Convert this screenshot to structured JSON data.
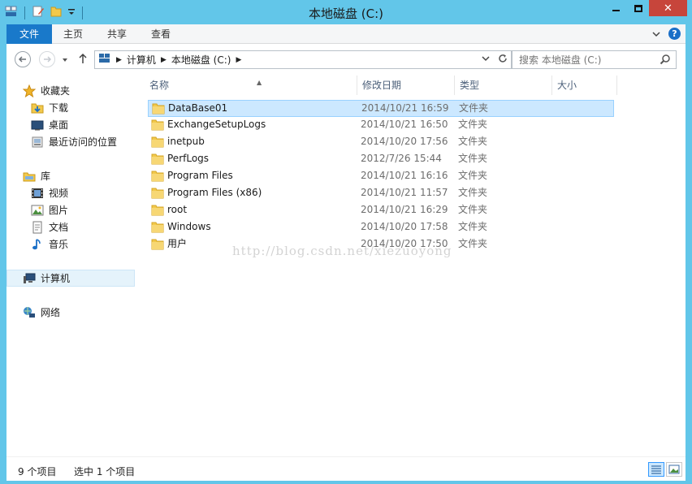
{
  "window": {
    "title": "本地磁盘 (C:)"
  },
  "ribbon": {
    "tabs": [
      "文件",
      "主页",
      "共享",
      "查看"
    ]
  },
  "address": {
    "path": [
      "计算机",
      "本地磁盘 (C:)"
    ],
    "search_placeholder": "搜索 本地磁盘 (C:)"
  },
  "sidebar": {
    "items": [
      {
        "label": "收藏夹",
        "icon": "star-icon"
      },
      {
        "label": "下载",
        "icon": "download-folder-icon"
      },
      {
        "label": "桌面",
        "icon": "desktop-icon"
      },
      {
        "label": "最近访问的位置",
        "icon": "recent-places-icon"
      },
      {
        "label": "库",
        "icon": "library-icon"
      },
      {
        "label": "视频",
        "icon": "video-icon"
      },
      {
        "label": "图片",
        "icon": "pictures-icon"
      },
      {
        "label": "文档",
        "icon": "documents-icon"
      },
      {
        "label": "音乐",
        "icon": "music-icon"
      },
      {
        "label": "计算机",
        "icon": "computer-icon"
      },
      {
        "label": "网络",
        "icon": "network-icon"
      }
    ]
  },
  "columns": {
    "name": "名称",
    "modified": "修改日期",
    "type": "类型",
    "size": "大小"
  },
  "files": [
    {
      "name": "DataBase01",
      "modified": "2014/10/21 16:59",
      "type": "文件夹"
    },
    {
      "name": "ExchangeSetupLogs",
      "modified": "2014/10/21 16:50",
      "type": "文件夹"
    },
    {
      "name": "inetpub",
      "modified": "2014/10/20 17:56",
      "type": "文件夹"
    },
    {
      "name": "PerfLogs",
      "modified": "2012/7/26 15:44",
      "type": "文件夹"
    },
    {
      "name": "Program Files",
      "modified": "2014/10/21 16:16",
      "type": "文件夹"
    },
    {
      "name": "Program Files (x86)",
      "modified": "2014/10/21 11:57",
      "type": "文件夹"
    },
    {
      "name": "root",
      "modified": "2014/10/21 16:29",
      "type": "文件夹"
    },
    {
      "name": "Windows",
      "modified": "2014/10/20 17:58",
      "type": "文件夹"
    },
    {
      "name": "用户",
      "modified": "2014/10/20 17:50",
      "type": "文件夹"
    }
  ],
  "watermark": "http://blog.csdn.net/xiezuoyong",
  "status": {
    "count": "9 个项目",
    "selected": "选中 1 个项目"
  },
  "colors": {
    "accent": "#1979ca",
    "frame": "#62c6e9",
    "selection": "#cce8ff",
    "close": "#c7453b"
  }
}
